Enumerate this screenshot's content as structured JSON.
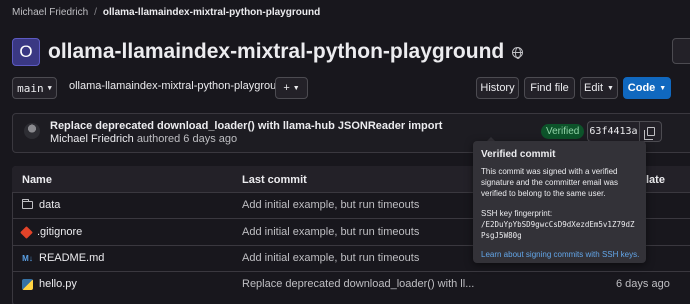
{
  "breadcrumb": {
    "owner": "Michael Friedrich",
    "separator": "/",
    "project": "ollama-llamaindex-mixtral-python-playground"
  },
  "project": {
    "avatar_letter": "O",
    "title": "ollama-llamaindex-mixtral-python-playground",
    "visibility_icon": "globe-icon"
  },
  "toolbar": {
    "branch": "main",
    "path": "ollama-llamaindex-mixtral-python-playground",
    "path_sep": "/",
    "plus_label": "+",
    "history_label": "History",
    "find_file_label": "Find file",
    "edit_label": "Edit",
    "code_label": "Code"
  },
  "last_commit": {
    "title": "Replace deprecated download_loader() with llama-hub JSONReader import",
    "author": "Michael Friedrich",
    "authored_text": "authored 6 days ago",
    "verified_label": "Verified",
    "sha": "63f4413a"
  },
  "table": {
    "headers": {
      "name": "Name",
      "last_commit": "Last commit",
      "last_update": "late"
    },
    "rows": [
      {
        "name": "data",
        "icon": "folder-icon",
        "commit": "Add initial example, but run timeouts",
        "date": ""
      },
      {
        "name": ".gitignore",
        "icon": "git-icon",
        "commit": "Add initial example, but run timeouts",
        "date": ""
      },
      {
        "name": "README.md",
        "icon": "markdown-icon",
        "commit": "Add initial example, but run timeouts",
        "date": ""
      },
      {
        "name": "hello.py",
        "icon": "python-icon",
        "commit": "Replace deprecated download_loader() with ll...",
        "date": "6 days ago"
      }
    ]
  },
  "tooltip": {
    "title": "Verified commit",
    "body": "This commit was signed with a verified signature and the committer email was verified to belong to the same user.",
    "fingerprint_label": "SSH key fingerprint:",
    "fingerprint": "/E2DuYpYbSD9gwcCsD9dXezdEm5v1Z79dZPsgJ5W80g",
    "link": "Learn about signing commits with SSH keys."
  },
  "colors": {
    "background": "#18171d",
    "accent": "#1068bf",
    "verified_bg": "#0d532a",
    "verified_text": "#91d4a8",
    "link": "#63a6e9"
  }
}
